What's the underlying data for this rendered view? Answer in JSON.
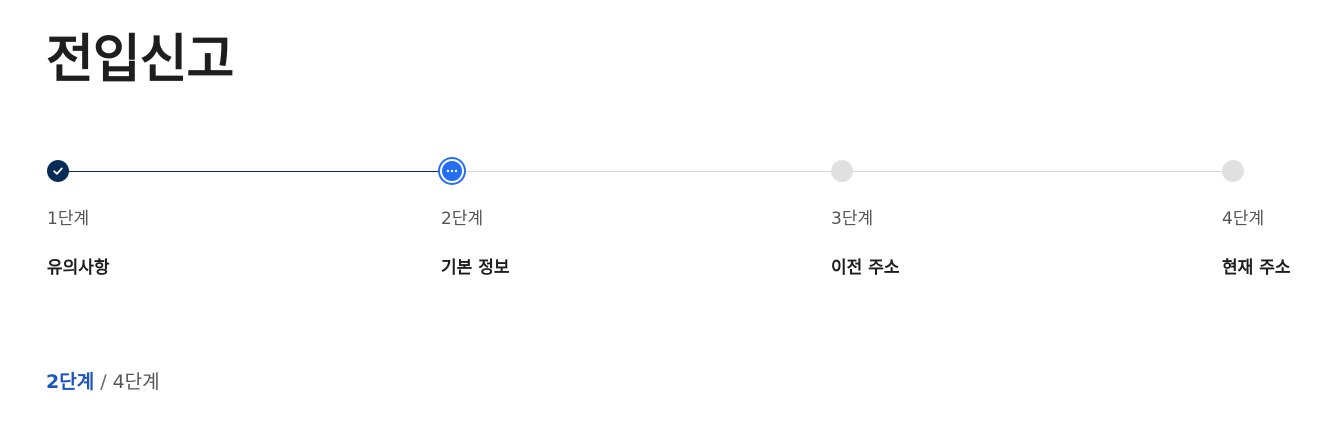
{
  "page": {
    "title": "전입신고"
  },
  "stepper": {
    "steps": [
      {
        "number_label": "1단계",
        "name": "유의사항",
        "status": "completed"
      },
      {
        "number_label": "2단계",
        "name": "기본 정보",
        "status": "current"
      },
      {
        "number_label": "3단계",
        "name": "이전 주소",
        "status": "pending"
      },
      {
        "number_label": "4단계",
        "name": "현재 주소",
        "status": "pending"
      }
    ],
    "icons": {
      "completed": "check-icon",
      "current": "ellipsis-icon"
    }
  },
  "progress": {
    "current": "2단계",
    "separator": "/",
    "total": "4단계"
  },
  "colors": {
    "completed": "#052b57",
    "current": "#256ef4",
    "pending": "#e0e0e0",
    "progress_accent": "#1d56bc"
  }
}
